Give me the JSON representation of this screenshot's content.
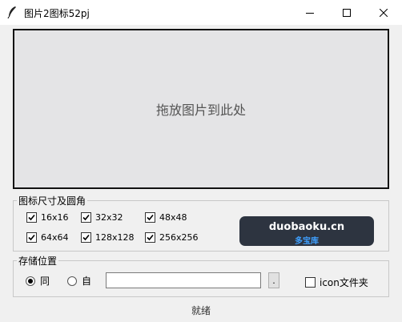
{
  "window": {
    "title": "图片2图标52pj",
    "controls": [
      "minimize",
      "maximize",
      "close"
    ]
  },
  "drop_zone": {
    "text": "拖放图片到此处"
  },
  "icon_sizes": {
    "legend": "图标尺寸及圆角",
    "options": [
      {
        "label": "16x16",
        "checked": true
      },
      {
        "label": "32x32",
        "checked": true
      },
      {
        "label": "48x48",
        "checked": true
      },
      {
        "label": "64x64",
        "checked": true
      },
      {
        "label": "128x128",
        "checked": true
      },
      {
        "label": "256x256",
        "checked": true
      }
    ]
  },
  "watermark": {
    "main": "duobaoku.cn",
    "sub": "多宝库"
  },
  "storage": {
    "legend": "存储位置",
    "radio_same": {
      "label": "同",
      "selected": true
    },
    "radio_custom": {
      "label": "自",
      "selected": false
    },
    "path_value": "",
    "browse_label": ".",
    "icon_folder": {
      "label": "icon文件夹",
      "checked": false
    }
  },
  "status": "就绪"
}
